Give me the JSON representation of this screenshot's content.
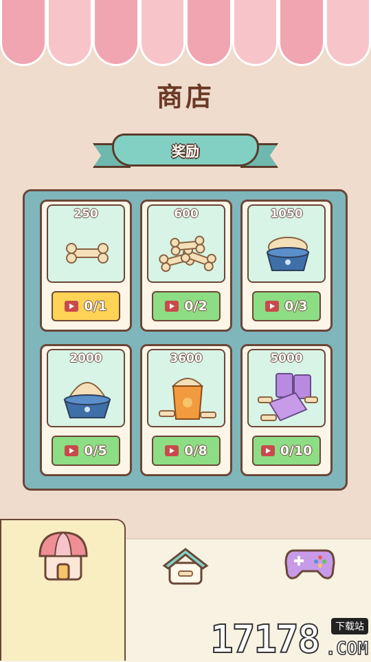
{
  "title": "商店",
  "section_label": "奖励",
  "cards": [
    {
      "amount": "250",
      "progress": "0/1",
      "button_color": "yellow",
      "art": "single-bone"
    },
    {
      "amount": "600",
      "progress": "0/2",
      "button_color": "green",
      "art": "bone-pile"
    },
    {
      "amount": "1050",
      "progress": "0/3",
      "button_color": "green",
      "art": "bowl-small"
    },
    {
      "amount": "2000",
      "progress": "0/5",
      "button_color": "green",
      "art": "bowl-large"
    },
    {
      "amount": "3600",
      "progress": "0/8",
      "button_color": "green",
      "art": "bag-orange"
    },
    {
      "amount": "5000",
      "progress": "0/10",
      "button_color": "green",
      "art": "bags-purple"
    }
  ],
  "tabs": [
    {
      "name": "shop",
      "icon": "shop-awning-icon",
      "active": true
    },
    {
      "name": "home",
      "icon": "dog-house-icon",
      "active": false
    },
    {
      "name": "games",
      "icon": "gamepad-icon",
      "active": false
    }
  ],
  "watermark": {
    "number": "17178",
    "badge": "下载站",
    "suffix": ".COM"
  },
  "colors": {
    "background": "#efdccd",
    "panel": "#7fb6bc",
    "ribbon": "#82d0c4",
    "title": "#6b3a26",
    "yellow_button": "#ffd356",
    "green_button": "#8ddd84"
  }
}
